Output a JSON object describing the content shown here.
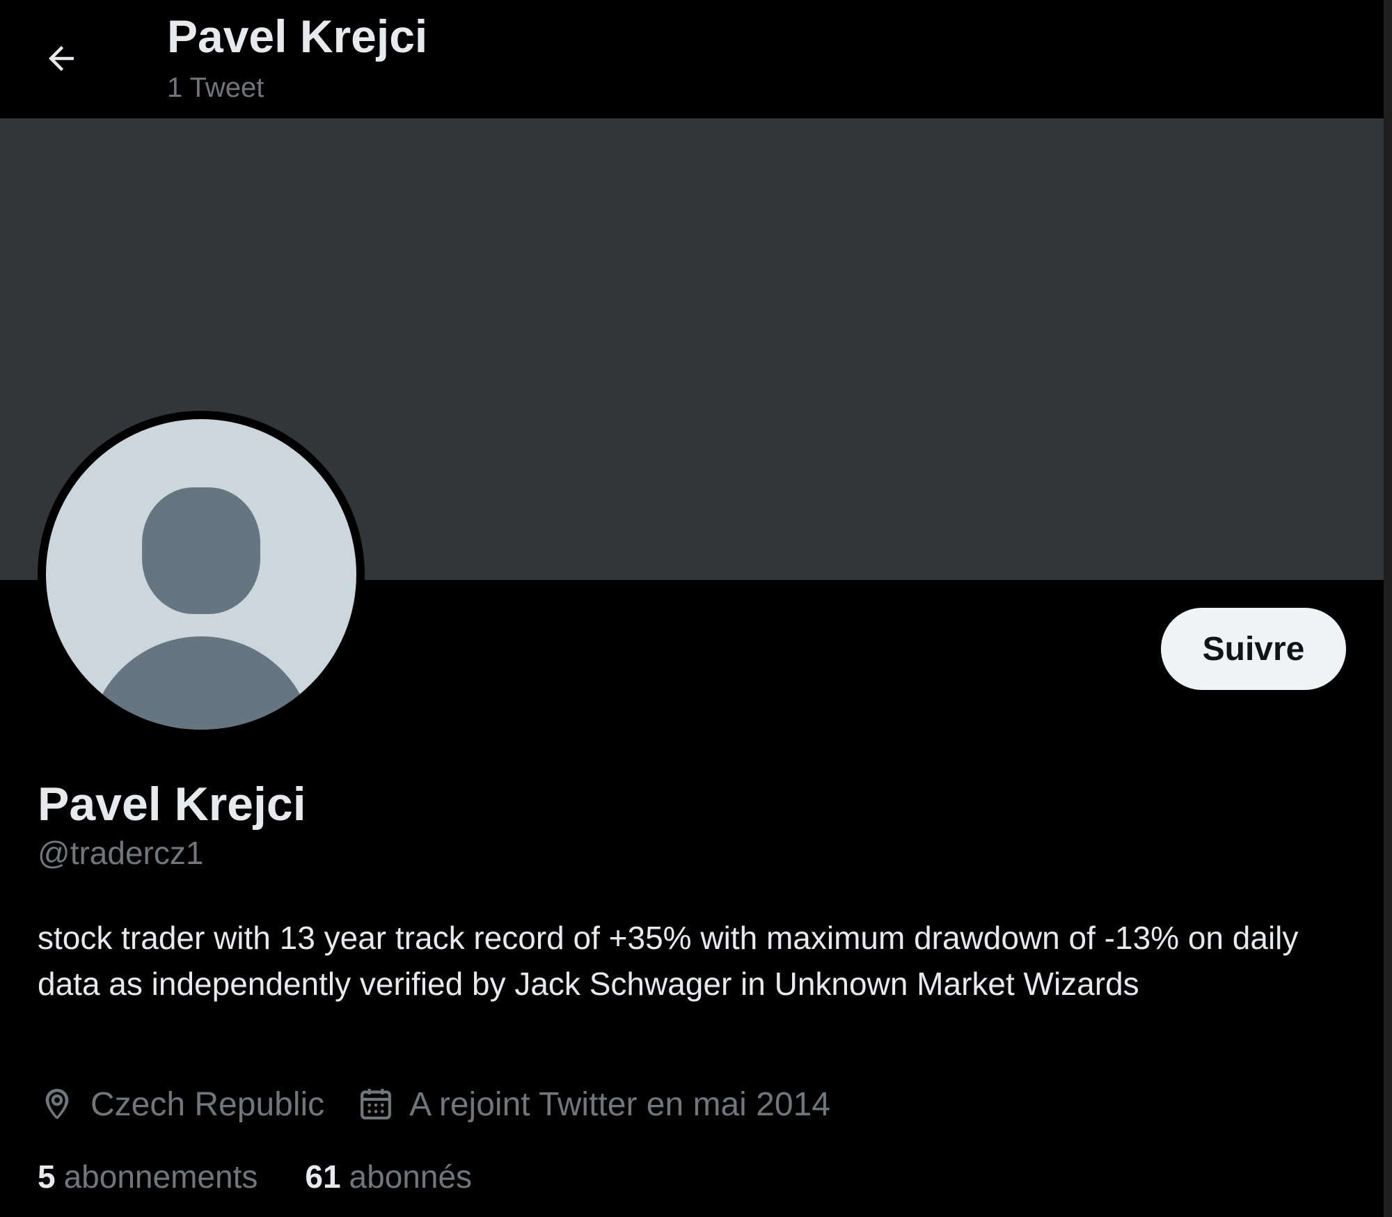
{
  "header": {
    "title": "Pavel Krejci",
    "tweet_count": "1 Tweet",
    "back_icon": "arrow-left-icon"
  },
  "profile": {
    "display_name": "Pavel Krejci",
    "handle": "@tradercz1",
    "bio": "stock trader with 13 year track record of +35% with maximum drawdown of -13% on daily data as independently verified by Jack Schwager in Unknown Market Wizards",
    "location": "Czech Republic",
    "joined": "A rejoint Twitter en mai 2014",
    "follow_label": "Suivre",
    "avatar_icon": "default-avatar-icon"
  },
  "stats": {
    "following_count": "5",
    "following_label": "abonnements",
    "followers_count": "61",
    "followers_label": "abonnés"
  },
  "colors": {
    "background": "#000000",
    "banner": "#333639",
    "primary_text": "#e7e9ea",
    "secondary_text": "#71767b",
    "follow_button_bg": "#eff3f4"
  }
}
